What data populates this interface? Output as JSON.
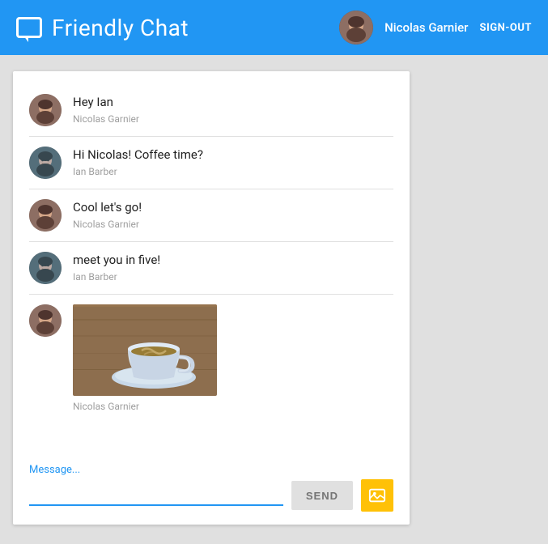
{
  "header": {
    "title": "Friendly Chat",
    "username": "Nicolas Garnier",
    "signout_label": "SIGN-OUT"
  },
  "messages": [
    {
      "id": 1,
      "text": "Hey Ian",
      "sender": "Nicolas Garnier",
      "avatar_type": "nicolas",
      "has_image": false
    },
    {
      "id": 2,
      "text": "Hi Nicolas! Coffee time?",
      "sender": "Ian Barber",
      "avatar_type": "ian",
      "has_image": false
    },
    {
      "id": 3,
      "text": "Cool let's go!",
      "sender": "Nicolas Garnier",
      "avatar_type": "nicolas",
      "has_image": false
    },
    {
      "id": 4,
      "text": "meet you in five!",
      "sender": "Ian Barber",
      "avatar_type": "ian",
      "has_image": false
    },
    {
      "id": 5,
      "text": "",
      "sender": "Nicolas Garnier",
      "avatar_type": "nicolas",
      "has_image": true
    }
  ],
  "input": {
    "label": "Message...",
    "placeholder": "",
    "send_button": "SEND"
  }
}
